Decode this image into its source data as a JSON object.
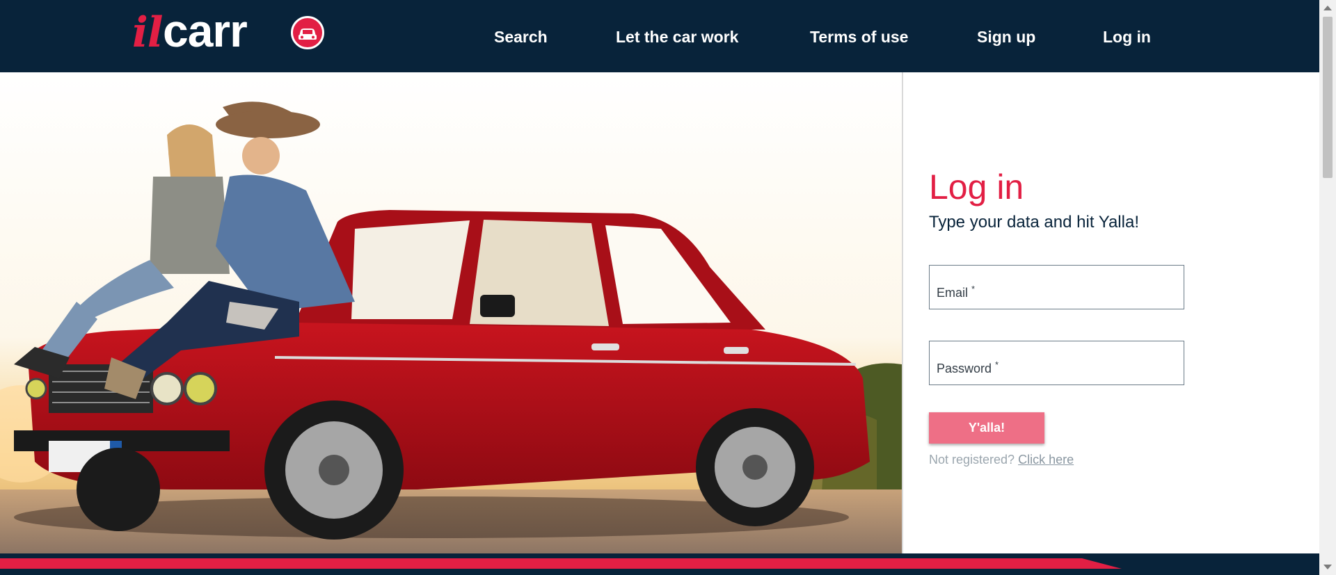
{
  "brand": {
    "logo_il": "il",
    "logo_carr": "carr",
    "colors": {
      "primary": "#e21f44",
      "navy": "#08233a",
      "button": "#ee6f86"
    }
  },
  "nav": {
    "items": [
      {
        "label": "Search"
      },
      {
        "label": "Let the car work"
      },
      {
        "label": "Terms of use"
      },
      {
        "label": "Sign up"
      },
      {
        "label": "Log in"
      }
    ]
  },
  "hero": {
    "image": "couple sitting on a red vintage sedan at sunset"
  },
  "login": {
    "title": "Log in",
    "subtitle": "Type your data and hit Yalla!",
    "email_label": "Email",
    "password_label": "Password",
    "required_mark": "*",
    "submit_label": "Y'alla!",
    "not_registered": "Not registered?",
    "register_link": "Click here"
  }
}
